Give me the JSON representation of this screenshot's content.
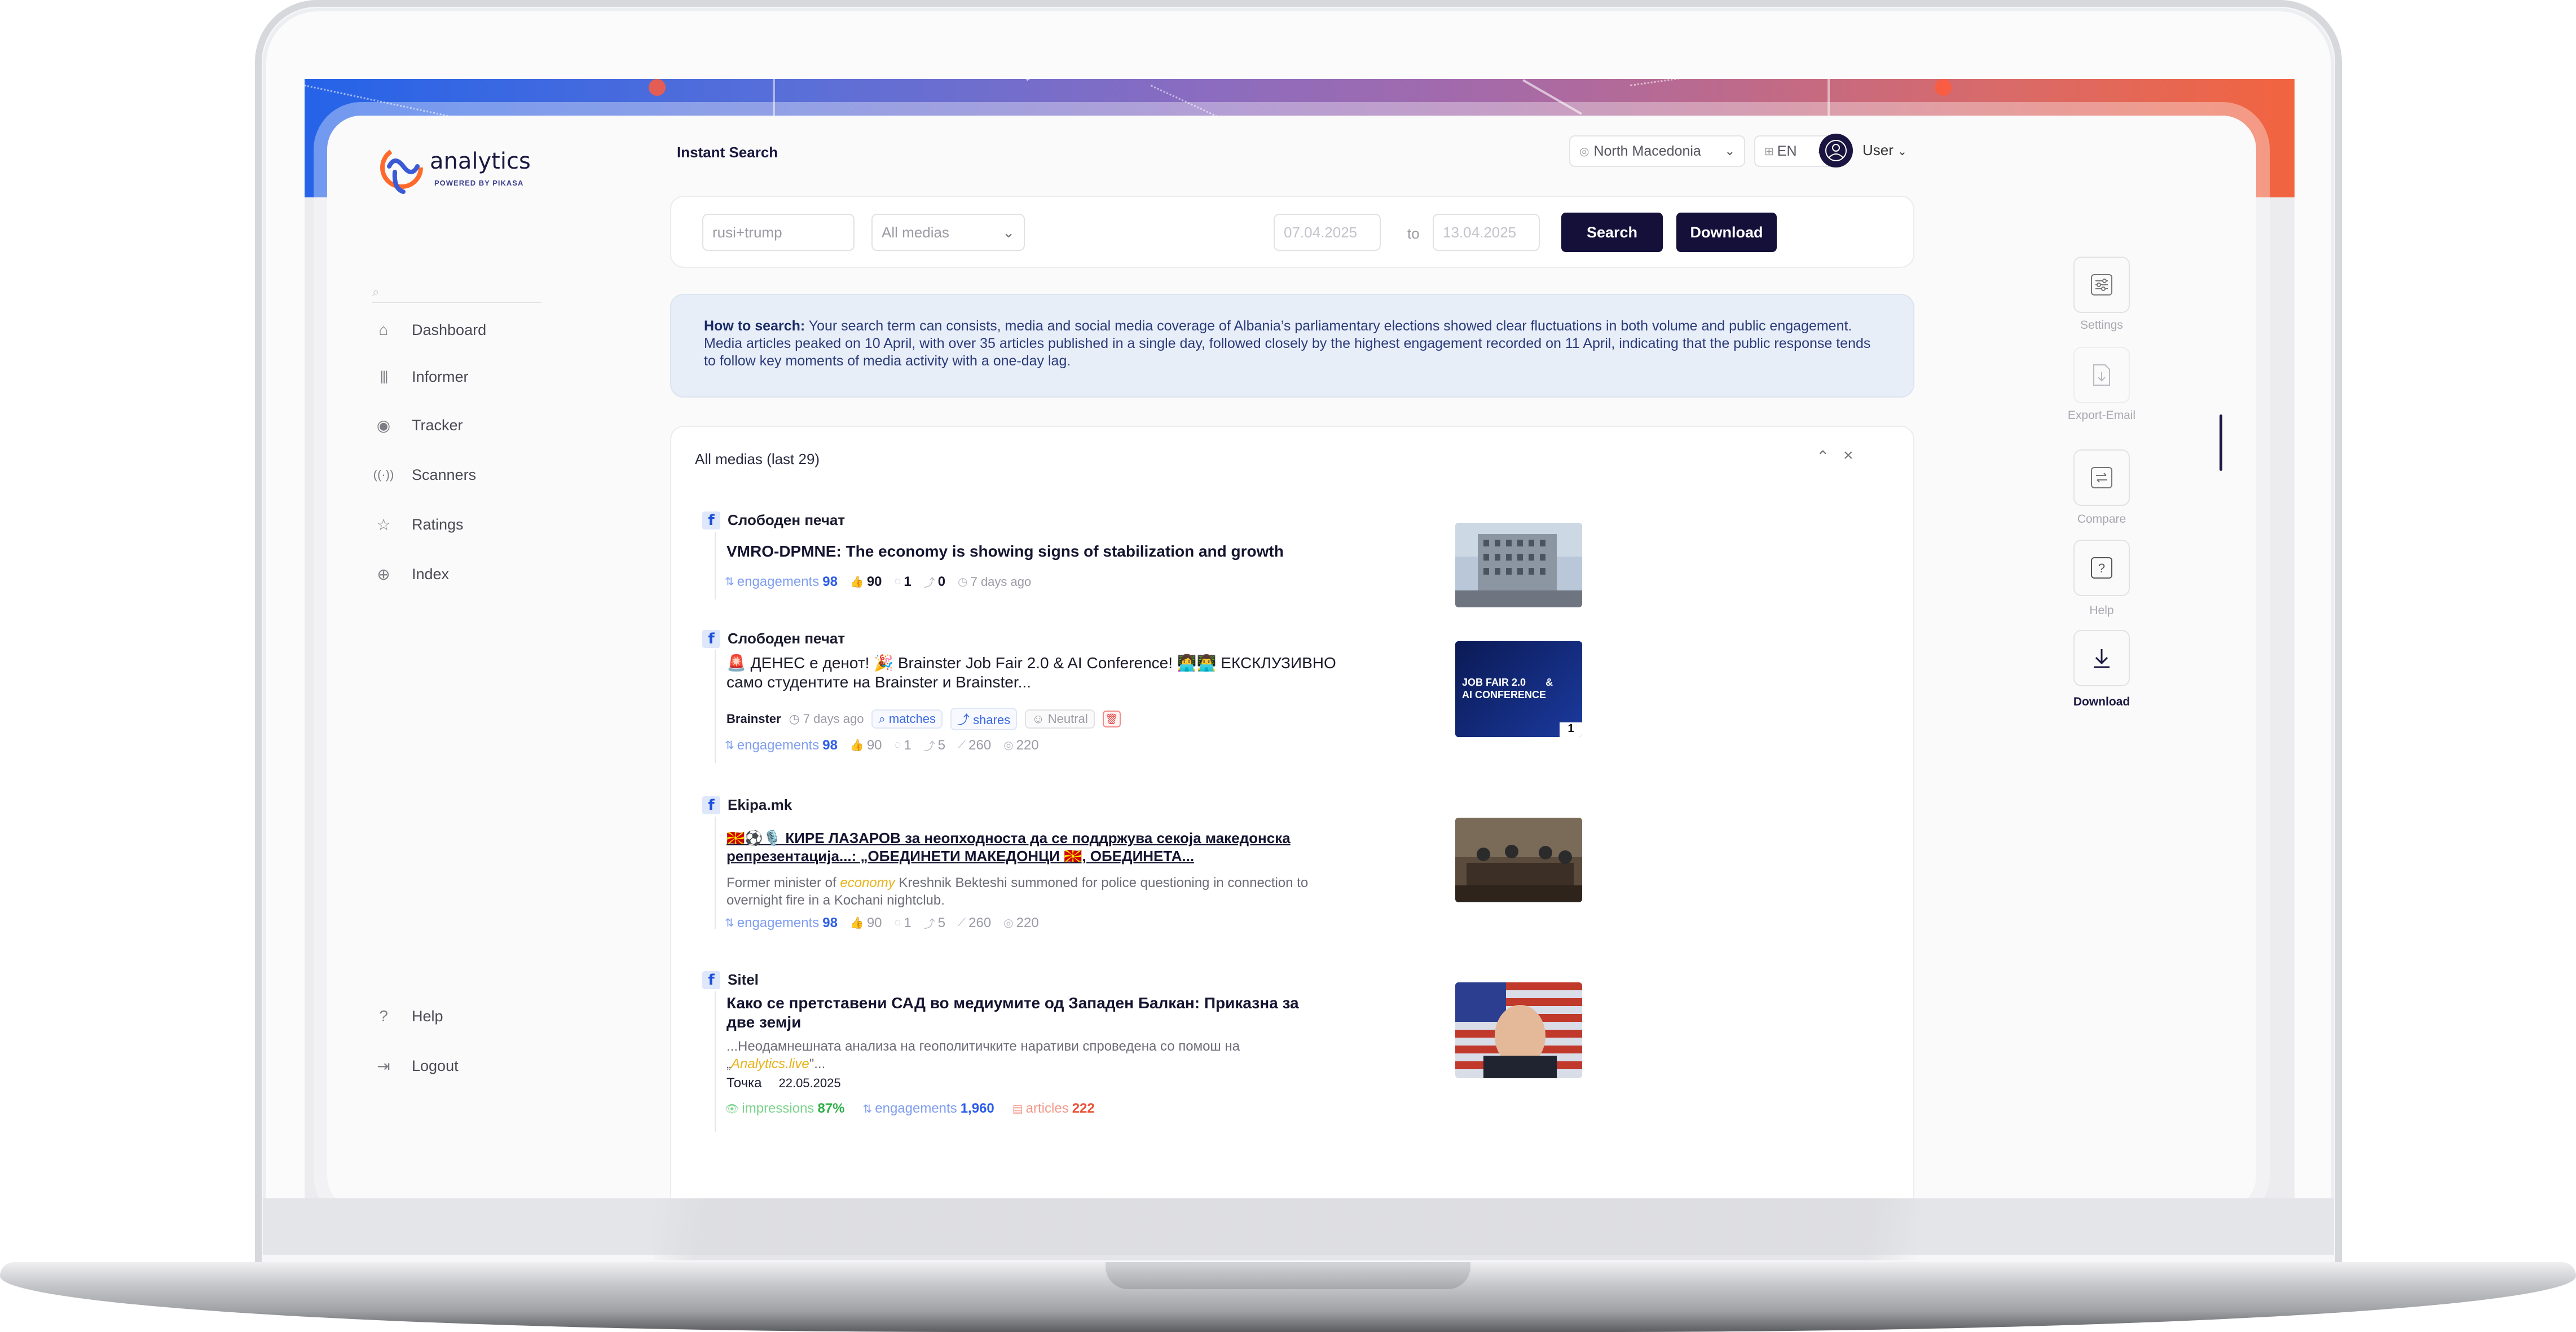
{
  "app": {
    "logo_word": "analytics",
    "logo_sub": "POWERED BY PIKASA",
    "page_title": "Instant Search"
  },
  "header": {
    "country": "North Macedonia",
    "language": "EN",
    "user": "User"
  },
  "sidebar": {
    "items": [
      {
        "label": "Dashboard",
        "icon": "home-icon"
      },
      {
        "label": "Informer",
        "icon": "bar-chart-icon"
      },
      {
        "label": "Tracker",
        "icon": "tracker-icon"
      },
      {
        "label": "Scanners",
        "icon": "broadcast-icon"
      },
      {
        "label": "Ratings",
        "icon": "star-icon"
      },
      {
        "label": "Index",
        "icon": "globe-icon"
      }
    ],
    "help": "Help",
    "logout": "Logout"
  },
  "search": {
    "query_placeholder": "rusi+trump",
    "media": "All medias",
    "date_from": "07.04.2025",
    "to_label": "to",
    "date_to": "13.04.2025",
    "search_label": "Search",
    "download_label": "Download"
  },
  "info": {
    "label": "How to search:",
    "text": " Your search term can consists, media and social media coverage of Albania’s parliamentary elections showed clear fluctuations in both volume and public engagement. Media articles peaked on 10 April, with over 35 articles published in a single day, followed closely by the highest engagement recorded on 11 April, indicating that the public response tends to follow key moments of media activity with a one-day lag."
  },
  "results": {
    "title": "All medias (last 29)",
    "posts": [
      {
        "source": "Слободен печат",
        "headline": "VMRO-DPMNE: The economy is showing signs of stabilization and growth",
        "eng_label": "engagements",
        "eng": "98",
        "likes": "90",
        "comments": "1",
        "shares": "0",
        "time": "7 days ago"
      },
      {
        "source": "Слободен печат",
        "headline": "🚨 ДЕНЕС е денот! 🎉 Brainster Job Fair 2.0 & AI Conference! 👩‍💻👨‍💻 ЕКСКЛУЗИВНО само студентите на Brainster и Brainster...",
        "author": "Brainster",
        "time": "7 days ago",
        "chip1": "matches",
        "chip2": "shares",
        "chip3": "Neutral",
        "eng_label": "engagements",
        "eng": "98",
        "likes": "90",
        "comments": "1",
        "shares": "5",
        "views": "260",
        "saves": "220",
        "thumb_text1": "JOB FAIR 2.0",
        "thumb_text2": "&",
        "thumb_text3": "AI CONFERENCE",
        "thumb_count": "1"
      },
      {
        "source": "Ekipa.mk",
        "headline": "🇲🇰⚽🎙️ КИРЕ ЛАЗАРОВ за неопходноста да се поддржува секоја македонска репрезентација...: „ОБЕДИНЕТИ МАКЕДОНЦИ 🇲🇰, ОБЕДИНЕТА...",
        "snippet_pre": "Former minister of ",
        "snippet_hl": "economy",
        "snippet_post": " Kreshnik Bekteshi summoned for police questioning in connection to overnight fire in a Kochani nightclub.",
        "eng_label": "engagements",
        "eng": "98",
        "likes": "90",
        "comments": "1",
        "shares": "5",
        "views": "260",
        "saves": "220"
      },
      {
        "source": "Sitel",
        "headline": "Како се претставени САД во медиумите од Западен Балкан: Приказна за две земји",
        "snippet_pre": "...Неодамнешната анализа на геополитичките наративи спроведена со помош на „",
        "snippet_hl": "Analytics.live",
        "snippet_post": "\"...",
        "author": "Точка",
        "date": "22.05.2025",
        "imp_label": "impressions",
        "imp": "87%",
        "eng_label": "engagements",
        "eng": "1,960",
        "art_label": "articles",
        "art": "222"
      }
    ]
  },
  "rail": {
    "settings": "Settings",
    "export": "Export-Email",
    "compare": "Compare",
    "help": "Help",
    "download": "Download"
  },
  "colors": {
    "accent": "#14103a",
    "banner_start": "#2563e8",
    "banner_end": "#f2643f",
    "engagement": "#2c5ce8"
  }
}
